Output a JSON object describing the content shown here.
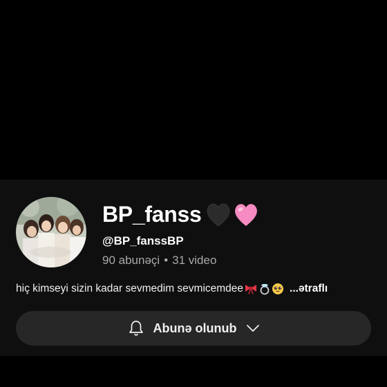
{
  "channel": {
    "name": "BP_fanss",
    "handle": "@BP_fanssBP",
    "subscribers": "90 abunəçi",
    "separator": "•",
    "videos": "31 video",
    "description": "hiç kimseyi sizin kadar sevmedim sevmicemdee",
    "description_emojis": [
      "ribbon-icon",
      "ring-icon",
      "pleading-face-icon"
    ],
    "more_label": "...ətraflı",
    "name_emojis": [
      "black-heart-icon",
      "pink-heart-icon"
    ]
  },
  "subscribe_button": {
    "label": "Abunə olunub",
    "icon": "bell-icon",
    "dropdown_icon": "chevron-down-icon"
  },
  "colors": {
    "page_background": "#000000",
    "header_background": "#0f0f0f",
    "button_background": "#272727",
    "secondary_text": "#aaaaaa",
    "pink_heart": "#f58bc0"
  }
}
